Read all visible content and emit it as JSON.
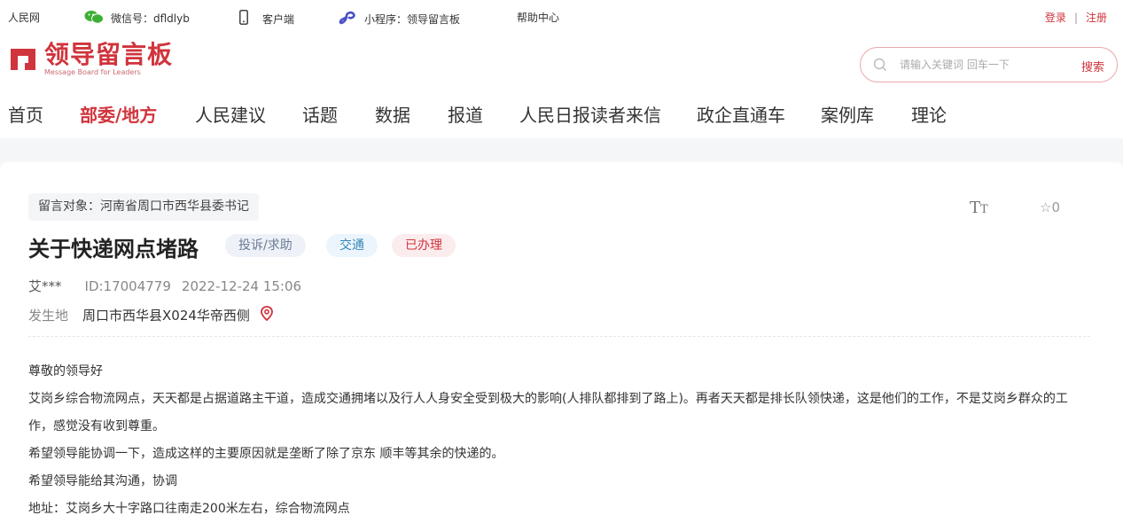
{
  "topbar": {
    "items": [
      {
        "label": "人民网"
      },
      {
        "label": "微信号：dfldlyb",
        "icon": "wechat-icon"
      },
      {
        "label": "客户端",
        "icon": "mobile-icon"
      },
      {
        "label": "小程序：领导留言板",
        "icon": "mini-program-icon"
      },
      {
        "label": "帮助中心"
      }
    ],
    "login_label": "登录",
    "register_label": "注册",
    "separator": "|"
  },
  "logo": {
    "title_cn": "领导留言板",
    "title_en": "Message Board for Leaders",
    "brand_color": "#d0343c"
  },
  "search": {
    "placeholder": "请输入关键词 回车一下",
    "button_label": "搜索"
  },
  "nav": {
    "items": [
      {
        "label": "首页",
        "active": false
      },
      {
        "label": "部委/地方",
        "active": true
      },
      {
        "label": "人民建议",
        "active": false
      },
      {
        "label": "话题",
        "active": false
      },
      {
        "label": "数据",
        "active": false
      },
      {
        "label": "报道",
        "active": false
      },
      {
        "label": "人民日报读者来信",
        "active": false
      },
      {
        "label": "政企直通车",
        "active": false
      },
      {
        "label": "案例库",
        "active": false
      },
      {
        "label": "理论",
        "active": false
      }
    ]
  },
  "message": {
    "target": "留言对象：河南省周口市西华县委书记",
    "font_size_icon_label": "TT",
    "favorite_count": "0",
    "title": "关于快递网点堵路",
    "tags": [
      {
        "label": "投诉/求助"
      },
      {
        "label": "交通"
      },
      {
        "label": "已办理"
      }
    ],
    "author": "艾***",
    "id": "ID:17004779",
    "datetime": "2022-12-24 15:06",
    "location_label": "发生地",
    "location_value": "周口市西华县X024华帝西侧",
    "content": [
      "尊敬的领导好",
      "艾岗乡综合物流网点，天天都是占据道路主干道，造成交通拥堵以及行人人身安全受到极大的影响(人排队都排到了路上)。再者天天都是排长队领快递，这是他们的工作，不是艾岗乡群众的工作，感觉没有收到尊重。",
      "希望领导能协调一下，造成这样的主要原因就是垄断了除了京东 顺丰等其余的快递的。",
      "希望领导能给其沟通，协调",
      "地址：艾岗乡大十字路口往南走200米左右，综合物流网点"
    ]
  }
}
